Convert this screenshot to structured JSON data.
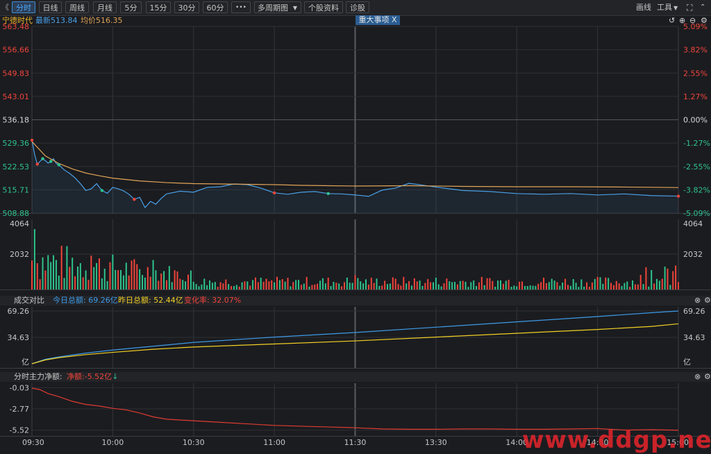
{
  "toolbar": {
    "back_label": "《",
    "periods": [
      "分时",
      "日线",
      "周线",
      "月线",
      "5分",
      "15分",
      "30分",
      "60分"
    ],
    "more_label": "•••",
    "multi_period_label": "多周期图",
    "stock_info_label": "个股资料",
    "diagnose_label": "诊股",
    "draw_label": "画线",
    "tools_label": "工具"
  },
  "info": {
    "stock_name": "宁德时代",
    "latest_label": "最新",
    "latest_value": "513.84",
    "avg_label": "均价",
    "avg_value": "516.35",
    "event_tag": "重大事项",
    "event_close": "X"
  },
  "turnover": {
    "title": "成交对比",
    "today_label": "今日总额:",
    "today_value": "69.26亿",
    "yesterday_label": "昨日总额:",
    "yesterday_value": "52.44亿",
    "change_label": "变化率:",
    "change_value": "32.07%"
  },
  "mainflow": {
    "title": "分时主力净额:",
    "net_label": "净额:",
    "net_value": "-5.52亿",
    "arrow": "↓"
  },
  "watermark": "www.ddgp.net",
  "colors": {
    "price_line": "#4aa0e6",
    "avg_line": "#e0a458",
    "up": "#f0453a",
    "down": "#2ec38c",
    "today_line": "#3d9be8",
    "yesterday_line": "#f2d024",
    "flow_line": "#e03c31"
  },
  "chart_data": [
    {
      "type": "line",
      "x_ticks": [
        "09:30",
        "10:00",
        "10:30",
        "11:00",
        "11:30",
        "13:30",
        "14:00",
        "14:30",
        "15:00"
      ],
      "y_ticks_left": [
        "563.48",
        "556.66",
        "549.83",
        "543.01",
        "536.18",
        "529.36",
        "522.53",
        "515.71",
        "508.88"
      ],
      "y_ticks_right": [
        "5.09%",
        "3.82%",
        "2.55%",
        "1.27%",
        "0.00%",
        "-1.27%",
        "-2.55%",
        "-3.82%",
        "-5.09%"
      ],
      "ylim": [
        508.88,
        563.48
      ],
      "reference": 536.18,
      "series": [
        {
          "name": "最新",
          "x": [
            0,
            1,
            2,
            3,
            4,
            5,
            6,
            7,
            8,
            9,
            10,
            12,
            14,
            16,
            18,
            20,
            22,
            24,
            26,
            28,
            30,
            32,
            34,
            36,
            38,
            40,
            42,
            44,
            46,
            48,
            50,
            55,
            60,
            65,
            70,
            75,
            80,
            85,
            90,
            95,
            100,
            105,
            110,
            115,
            120,
            125,
            130,
            135,
            140,
            150,
            160,
            170,
            180,
            190,
            200,
            210,
            220,
            230,
            240
          ],
          "values": [
            530.2,
            526.0,
            523.2,
            524.0,
            524.8,
            524.2,
            523.5,
            524.0,
            524.8,
            523.4,
            523.0,
            521.5,
            520.5,
            519.2,
            517.5,
            515.5,
            516.0,
            517.5,
            515.5,
            514.7,
            516.4,
            516.0,
            515.4,
            514.4,
            512.9,
            513.5,
            510.5,
            512.3,
            511.5,
            513.2,
            514.5,
            515.3,
            515.0,
            516.4,
            516.6,
            517.4,
            517.2,
            516.2,
            514.8,
            514.4,
            515.0,
            515.2,
            514.6,
            514.5,
            514.2,
            513.8,
            515.6,
            516.2,
            517.6,
            516.5,
            515.5,
            515.2,
            514.6,
            514.4,
            514.6,
            514.2,
            514.5,
            514.0,
            513.84
          ]
        },
        {
          "name": "均价",
          "x": [
            0,
            5,
            10,
            15,
            20,
            25,
            30,
            40,
            50,
            60,
            70,
            80,
            90,
            100,
            110,
            120,
            140,
            160,
            180,
            200,
            220,
            240
          ],
          "values": [
            529.8,
            525.6,
            523.4,
            521.8,
            520.6,
            519.8,
            519.1,
            518.3,
            517.8,
            517.5,
            517.4,
            517.3,
            517.2,
            517.0,
            516.9,
            516.8,
            516.9,
            516.7,
            516.6,
            516.6,
            516.5,
            516.35
          ]
        }
      ]
    },
    {
      "type": "bar",
      "y_ticks": [
        "4064",
        "2032"
      ],
      "ylim": [
        0,
        4064
      ]
    },
    {
      "type": "line",
      "y_ticks": [
        "69.26",
        "34.63",
        "亿"
      ],
      "ylim": [
        0,
        69.26
      ],
      "series": [
        {
          "name": "今日总额",
          "x": [
            0,
            5,
            10,
            20,
            30,
            45,
            60,
            90,
            120,
            150,
            180,
            210,
            230,
            240
          ],
          "values": [
            0,
            6,
            9,
            14,
            18,
            23,
            28,
            35,
            41,
            48,
            55,
            62,
            67,
            69.26
          ]
        },
        {
          "name": "昨日总额",
          "x": [
            0,
            5,
            10,
            20,
            30,
            45,
            60,
            90,
            120,
            150,
            180,
            210,
            230,
            240
          ],
          "values": [
            0,
            5,
            8,
            12,
            15,
            19,
            22,
            26,
            30,
            35,
            40,
            45,
            49,
            52.44
          ]
        }
      ]
    },
    {
      "type": "line",
      "y_ticks": [
        "-0.03",
        "-2.77",
        "-5.52"
      ],
      "ylim": [
        -5.9,
        0
      ],
      "series": [
        {
          "name": "分时主力净额",
          "x": [
            0,
            3,
            6,
            10,
            15,
            20,
            25,
            30,
            35,
            40,
            45,
            50,
            55,
            60,
            70,
            80,
            90,
            100,
            110,
            120,
            130,
            140,
            150,
            160,
            170,
            180,
            190,
            200,
            210,
            220,
            230,
            240
          ],
          "values": [
            -0.1,
            -0.3,
            -0.8,
            -1.2,
            -1.8,
            -2.2,
            -2.4,
            -2.7,
            -2.9,
            -3.3,
            -3.8,
            -4.1,
            -4.2,
            -4.3,
            -4.5,
            -4.7,
            -4.9,
            -5.0,
            -5.1,
            -5.2,
            -5.35,
            -5.4,
            -5.4,
            -5.35,
            -5.35,
            -5.4,
            -5.4,
            -5.35,
            -5.3,
            -5.5,
            -5.45,
            -5.52
          ]
        }
      ]
    }
  ]
}
